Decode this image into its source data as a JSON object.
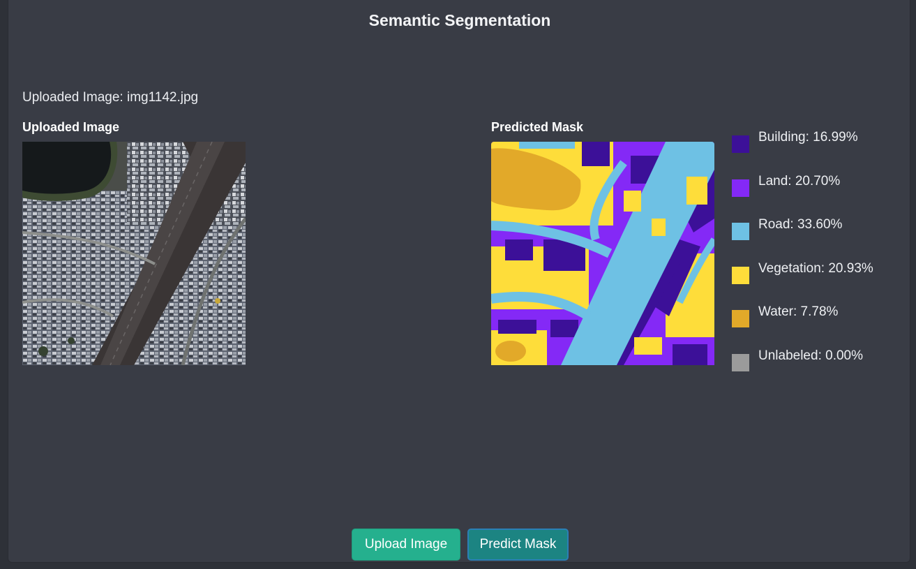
{
  "header": {
    "title": "Semantic Segmentation"
  },
  "upload_status": "Uploaded Image: img1142.jpg",
  "uploaded_panel": {
    "label": "Uploaded Image"
  },
  "mask_panel": {
    "label": "Predicted Mask"
  },
  "legend": [
    {
      "name": "Building",
      "text": "Building: 16.99%",
      "percent": 16.99,
      "color": "#3c1098"
    },
    {
      "name": "Land",
      "text": "Land: 20.70%",
      "percent": 20.7,
      "color": "#8429f6"
    },
    {
      "name": "Road",
      "text": "Road: 33.60%",
      "percent": 33.6,
      "color": "#6ec1e4"
    },
    {
      "name": "Vegetation",
      "text": "Vegetation: 20.93%",
      "percent": 20.93,
      "color": "#fedd3a"
    },
    {
      "name": "Water",
      "text": "Water: 7.78%",
      "percent": 7.78,
      "color": "#e2a929"
    },
    {
      "name": "Unlabeled",
      "text": "Unlabeled: 0.00%",
      "percent": 0.0,
      "color": "#9b9b9b"
    }
  ],
  "buttons": {
    "upload_label": "Upload Image",
    "predict_label": "Predict Mask",
    "upload_color": "#25b08e",
    "predict_color": "#1c8482"
  }
}
